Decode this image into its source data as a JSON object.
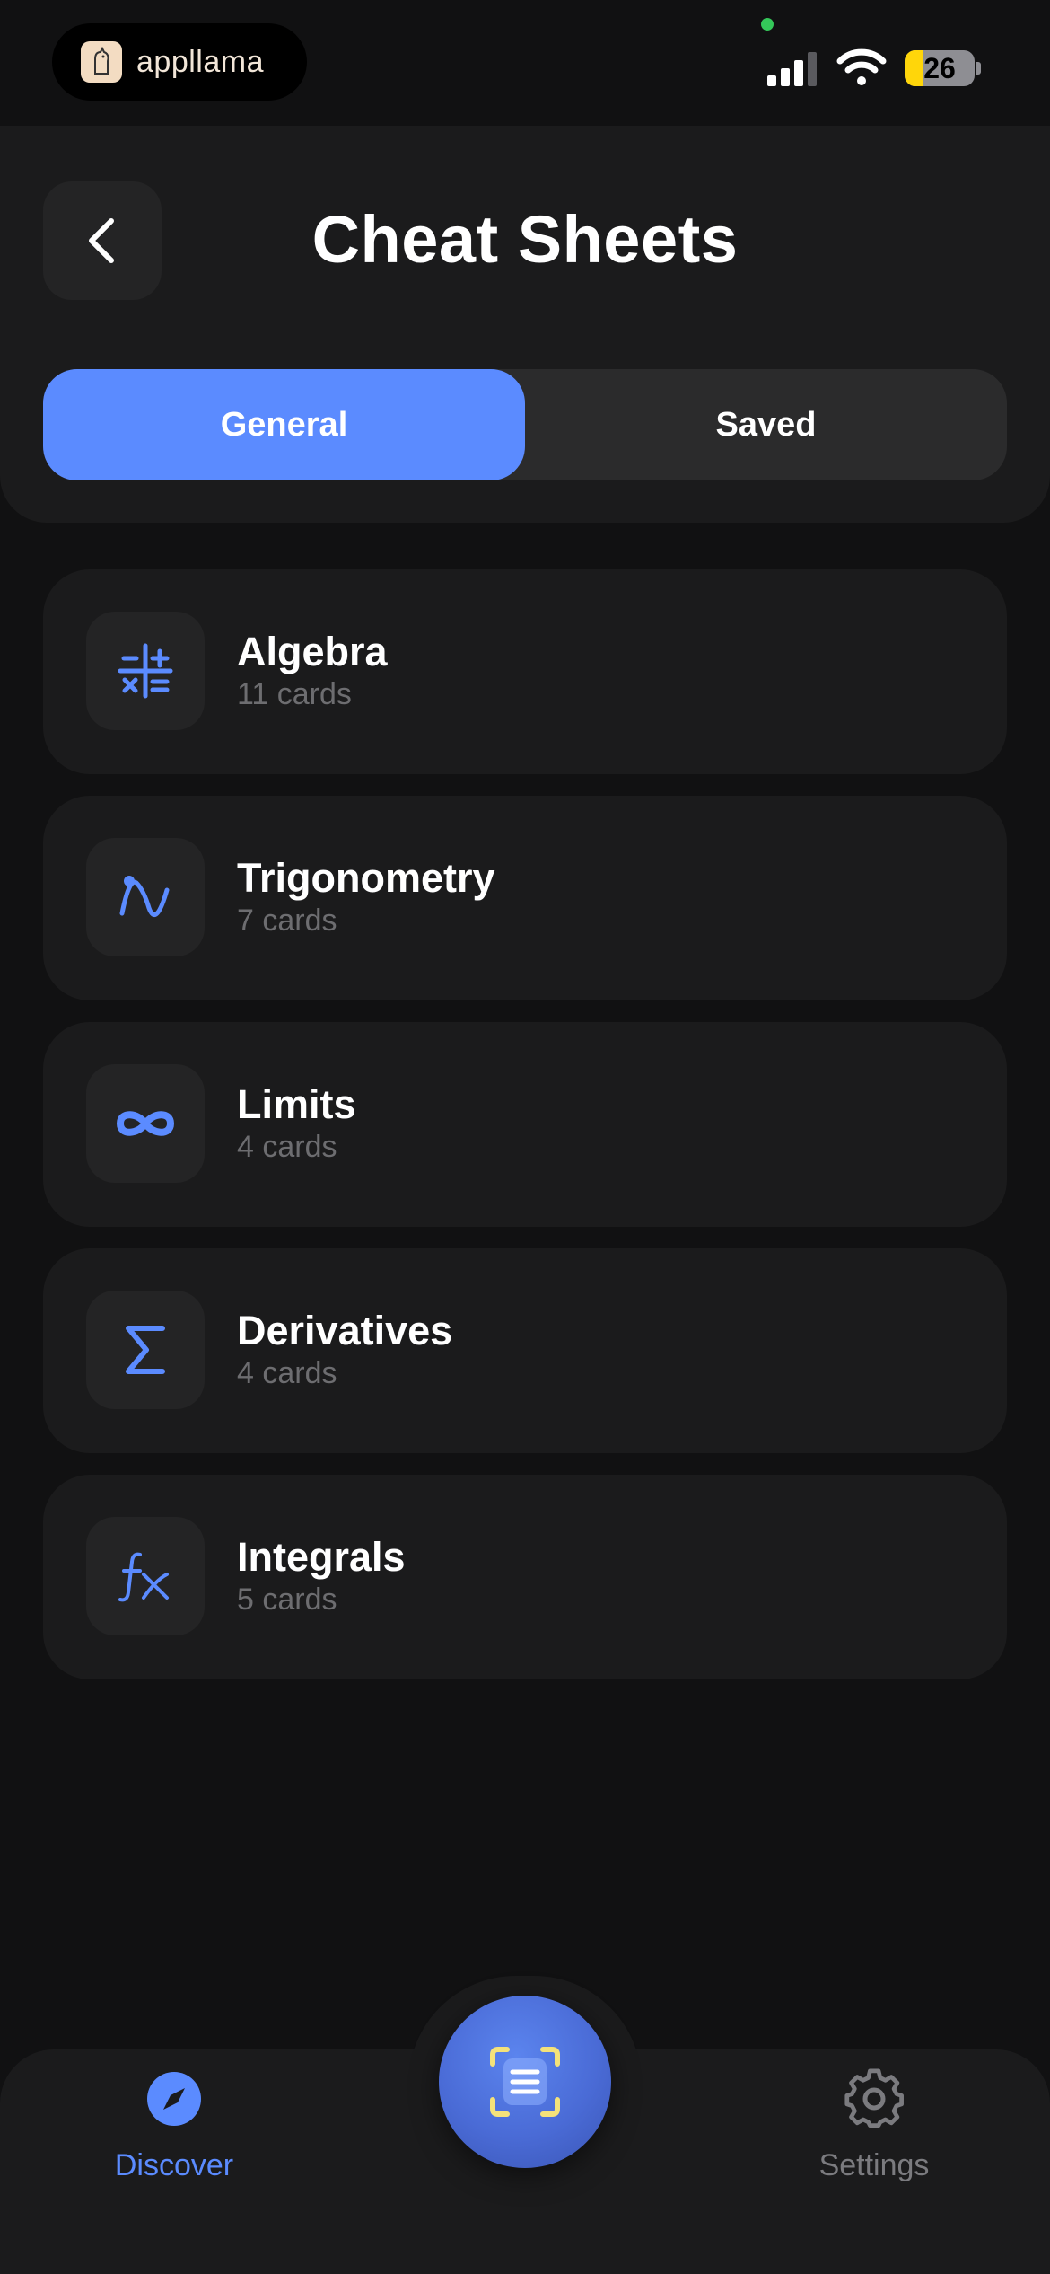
{
  "status_bar": {
    "brand_name": "appllama",
    "battery": "26"
  },
  "header": {
    "title": "Cheat Sheets"
  },
  "segments": [
    {
      "label": "General",
      "active": true
    },
    {
      "label": "Saved",
      "active": false
    }
  ],
  "sheets": [
    {
      "title": "Algebra",
      "count": "11 cards",
      "icon": "algebra-operators-icon"
    },
    {
      "title": "Trigonometry",
      "count": "7 cards",
      "icon": "sine-wave-icon"
    },
    {
      "title": "Limits",
      "count": "4 cards",
      "icon": "infinity-icon"
    },
    {
      "title": "Derivatives",
      "count": "4 cards",
      "icon": "sigma-icon"
    },
    {
      "title": "Integrals",
      "count": "5 cards",
      "icon": "function-fx-icon"
    }
  ],
  "nav": {
    "discover_label": "Discover",
    "settings_label": "Settings"
  },
  "colors": {
    "accent": "#5b8bff",
    "background": "#111112",
    "card": "#1b1b1c",
    "muted_text": "#6d6d70"
  }
}
